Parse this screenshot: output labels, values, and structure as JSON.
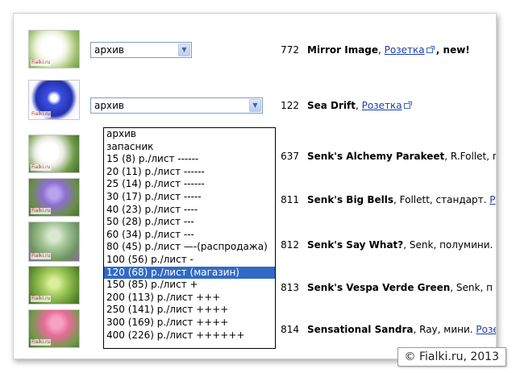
{
  "rows": [
    {
      "select_value": "архив",
      "num": "772",
      "name": "Mirror Image",
      "sep": ", ",
      "link": "Розетка",
      "suffix": " , new!",
      "photo_colors": [
        "#f4f7ea",
        "#9cc06c"
      ]
    },
    {
      "select_value": "архив",
      "num": "122",
      "name": "Sea Drift",
      "sep": ", ",
      "link": "Розетка",
      "suffix": "",
      "photo_colors": [
        "#2b3fc8",
        "#ffffff"
      ]
    },
    {
      "select_value": "",
      "num": "637",
      "name": "Senk's Alchemy Parakeet",
      "sep": ", ",
      "text": "R.Follet, п",
      "link": "",
      "suffix": "",
      "photo_colors": [
        "#f2f2ec",
        "#5a8a3a"
      ]
    },
    {
      "select_value": "",
      "num": "811",
      "name": "Senk's Big Bells",
      "sep": ", ",
      "text": "Follett, стандарт. ",
      "link": "Р",
      "suffix": "",
      "photo_colors": [
        "#8d6fd0",
        "#5d8a3e"
      ]
    },
    {
      "select_value": "",
      "num": "812",
      "name": "Senk's Say What?",
      "sep": ", ",
      "text": "Senk, полумини. ",
      "link": "",
      "suffix": "",
      "photo_colors": [
        "#a8c89a",
        "#6e9462"
      ]
    },
    {
      "select_value": "",
      "num": "813",
      "name": "Senk's Vespa Verde Green",
      "sep": ", ",
      "text": "Senk, п",
      "link": "",
      "suffix": "",
      "photo_colors": [
        "#a9cf62",
        "#6a9a36"
      ]
    },
    {
      "select_value": "",
      "num": "814",
      "name": "Sensational Sandra",
      "sep": ", ",
      "text": "Ray, мини. ",
      "link": "Розе",
      "suffix": "",
      "photo_colors": [
        "#e76c98",
        "#6e9b4a"
      ]
    }
  ],
  "watermark": "Fialki.ru",
  "dropdown": {
    "options": [
      "архив",
      "запасник",
      "15 (8) р./лист ------",
      "20 (11) р./лист ------",
      "25 (14) р./лист ------",
      "30 (17) р./лист -----",
      "40 (23) р./лист ----",
      "50 (28) р./лист ---",
      "60 (34) р./лист ---",
      "80 (45) р./лист —-(распродажа)",
      "100 (56) р./лист -",
      "120 (68) р./лист (магазин)",
      "150 (85) р./лист +",
      "200 (113) р./лист +++",
      "250 (141) р./лист ++++",
      "300 (169) р./лист ++++",
      "400 (226) р./лист ++++++"
    ],
    "selected_index": 11
  },
  "copyright": "© Fialki.ru, 2013"
}
